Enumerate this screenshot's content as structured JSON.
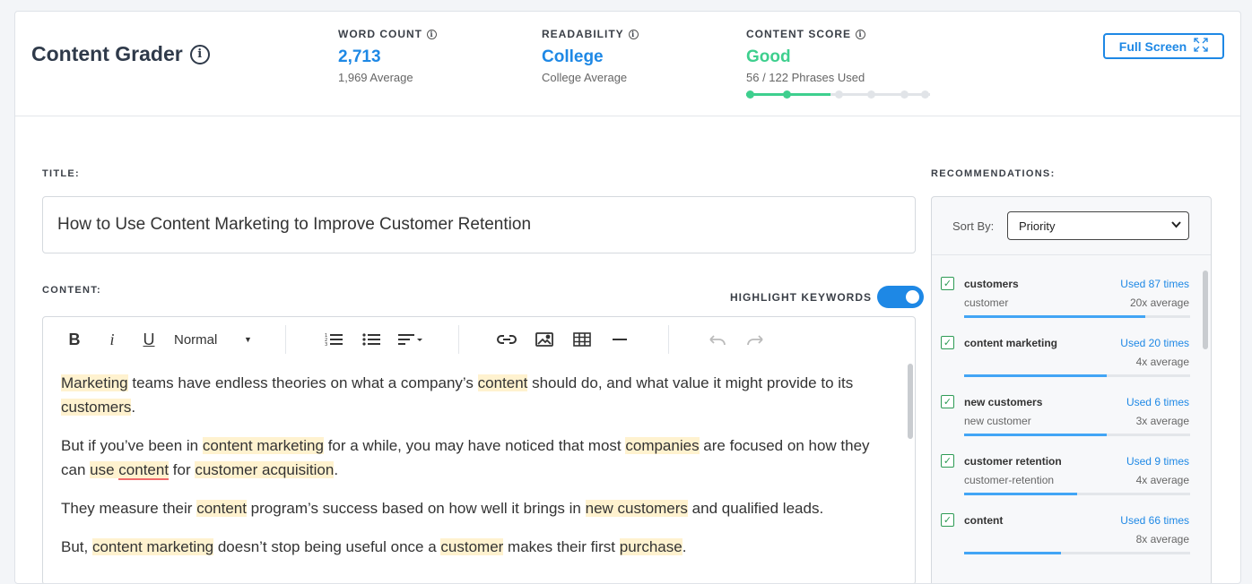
{
  "app": {
    "title": "Content Grader"
  },
  "stats": [
    {
      "label": "WORD COUNT",
      "value": "2,713",
      "sub": "1,969 Average"
    },
    {
      "label": "READABILITY",
      "value": "College",
      "sub": "College Average"
    },
    {
      "label": "CONTENT SCORE",
      "value": "Good",
      "sub": "56 / 122 Phrases Used",
      "progress_fraction": 0.46
    }
  ],
  "full_screen_label": "Full Screen",
  "title_section": {
    "label": "TITLE:",
    "value": "How to Use Content Marketing to Improve Customer Retention"
  },
  "content_section": {
    "label": "CONTENT:",
    "highlight_label": "HIGHLIGHT KEYWORDS",
    "highlight_on": true
  },
  "toolbar": {
    "bold": "B",
    "italic": "i",
    "underline": "U",
    "format": "Normal"
  },
  "colors": {
    "accent": "#1e88e5",
    "good": "#3ecf8e",
    "highlight": "#fff2cf",
    "check": "#2e9b55"
  },
  "content": {
    "p1": {
      "s1": "Marketing",
      "s2": " teams have endless theories on what a company’s ",
      "s3": "content",
      "s4": " should do, and what value it might provide to its ",
      "s5": "customers",
      "s6": "."
    },
    "p2": {
      "s1": "But if you’ve been in ",
      "s2": "content marketing",
      "s3": " for a while, you may have noticed that most ",
      "s4": "companies",
      "s5": " are focused on how they can ",
      "s6": "use ",
      "s7": "content",
      "s8": " for ",
      "s9": "customer acquisition",
      "s10": "."
    },
    "p3": {
      "s1": "They measure their ",
      "s2": "content",
      "s3": " program’s success based on how well it brings in ",
      "s4": "new customers",
      "s5": " and qualified leads."
    },
    "p4": {
      "s1": "But, ",
      "s2": "content marketing",
      "s3": " doesn’t stop being useful once a ",
      "s4": "customer",
      "s5": " makes their first ",
      "s6": "purchase",
      "s7": "."
    }
  },
  "recommendations": {
    "label": "RECOMMENDATIONS:",
    "sort_label": "Sort By:",
    "sort_value": "Priority",
    "items": [
      {
        "keyword": "customers",
        "used": "Used 87 times",
        "variant": "customer",
        "avg": "20x average",
        "fraction": 0.8
      },
      {
        "keyword": "content marketing",
        "used": "Used 20 times",
        "variant": "",
        "avg": "4x average",
        "fraction": 0.63
      },
      {
        "keyword": "new customers",
        "used": "Used 6 times",
        "variant": "new customer",
        "avg": "3x average",
        "fraction": 0.63
      },
      {
        "keyword": "customer retention",
        "used": "Used 9 times",
        "variant": "customer-retention",
        "avg": "4x average",
        "fraction": 0.5
      },
      {
        "keyword": "content",
        "used": "Used 66 times",
        "variant": "",
        "avg": "8x average",
        "fraction": 0.43
      }
    ]
  }
}
